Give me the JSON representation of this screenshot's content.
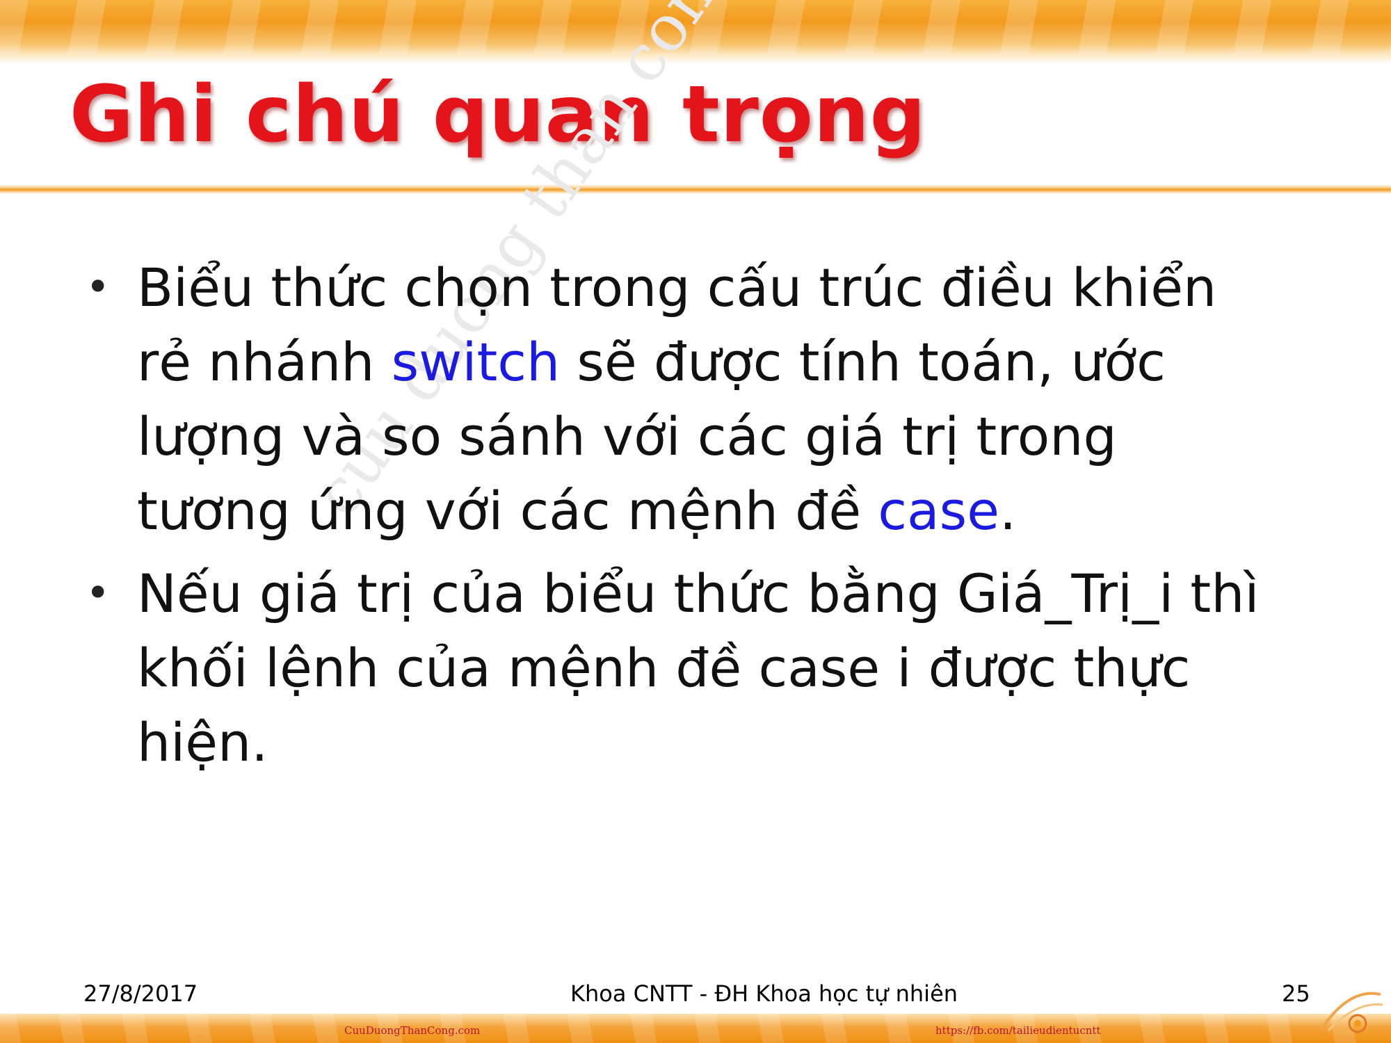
{
  "slide": {
    "title": "Ghi chú quan trọng",
    "bullets": [
      {
        "parts": [
          "Biểu thức chọn trong cấu trúc điều khiển rẻ nhánh ",
          "switch",
          " sẽ được tính toán, ước lượng và so sánh với các giá trị trong tương ứng với các mệnh đề ",
          "case",
          "."
        ]
      },
      {
        "text": "Nếu giá trị của biểu thức bằng Giá_Trị_i thì khối lệnh của mệnh đề case i được thực hiện."
      }
    ],
    "watermark": "cuu duong than cong . com"
  },
  "footer": {
    "date": "27/8/2017",
    "center": "Khoa CNTT - ĐH Khoa học tự nhiên",
    "page": "25",
    "credit_left": "CuuDuongThanCong.com",
    "credit_right": "https://fb.com/tailieudientucntt"
  },
  "colors": {
    "title": "#e4141b",
    "keyword": "#1a1ae0",
    "accent": "#f29a1e"
  }
}
